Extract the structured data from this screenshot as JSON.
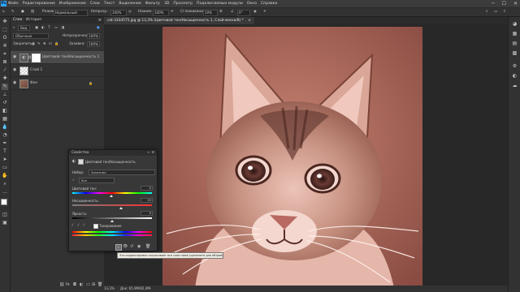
{
  "app": {
    "logo": "Ps",
    "menu": [
      "Файл",
      "Редактирование",
      "Изображение",
      "Слои",
      "Текст",
      "Выделение",
      "Фильтр",
      "3D",
      "Просмотр",
      "Подключаемые модули",
      "Окно",
      "Справка"
    ],
    "window_controls": [
      "─",
      "☐",
      "✕"
    ]
  },
  "options_bar": {
    "mode_label": "Режим:",
    "mode_value": "Нормальный",
    "opacity_label": "Непрозр.:",
    "opacity_value": "100%",
    "flow_label": "Нажим:",
    "flow_value": "100%",
    "smoothing_label": "Сглаживание:",
    "smoothing_value": "10%",
    "angle_value": "0°"
  },
  "layers_panel": {
    "tabs": [
      "Слои",
      "История"
    ],
    "kind_label": "Вид",
    "blend_mode": "Обычные",
    "opacity_label": "Непрозрачность:",
    "opacity_value": "100%",
    "lock_label": "Закрепить:",
    "fill_label": "Заливка:",
    "fill_value": "100%",
    "layers": [
      {
        "name": "Цветовой тон/Насыщенность 1",
        "selected": true,
        "thumb": "adjustment-icon"
      },
      {
        "name": "Слой 1",
        "selected": false,
        "thumb": "checker"
      },
      {
        "name": "Фон",
        "selected": false,
        "thumb": "photo"
      }
    ]
  },
  "document": {
    "tab_title": "cat-3334575.jpg @ 13,3% (Цветовой тон/Насыщенность 1, Слой-маска/8) *",
    "tab_close": "×"
  },
  "status": {
    "zoom": "13,3%",
    "doc_info": "Док: 65,9M/82,4M"
  },
  "properties": {
    "title": "Свойства",
    "subtitle": "Цветовой тон/Насыщенность",
    "preset_label": "Набор:",
    "preset_value": "Заказная",
    "channel_value": "Все",
    "hue_label": "Цветовой тон:",
    "hue_value": "-5",
    "sat_label": "Насыщенность:",
    "sat_value": "25",
    "light_label": "Яркость:",
    "light_value": "0",
    "colorize_label": "Тонирование"
  },
  "tooltip": "Эта корректировка затрагивает все слои ниже (щелкните для обтравочной маски слоя)",
  "colors": {
    "accent": "#2fa3f7",
    "selected_layer": "#4a4a4a",
    "panel": "#323232",
    "canvas_bg": "#282828"
  }
}
